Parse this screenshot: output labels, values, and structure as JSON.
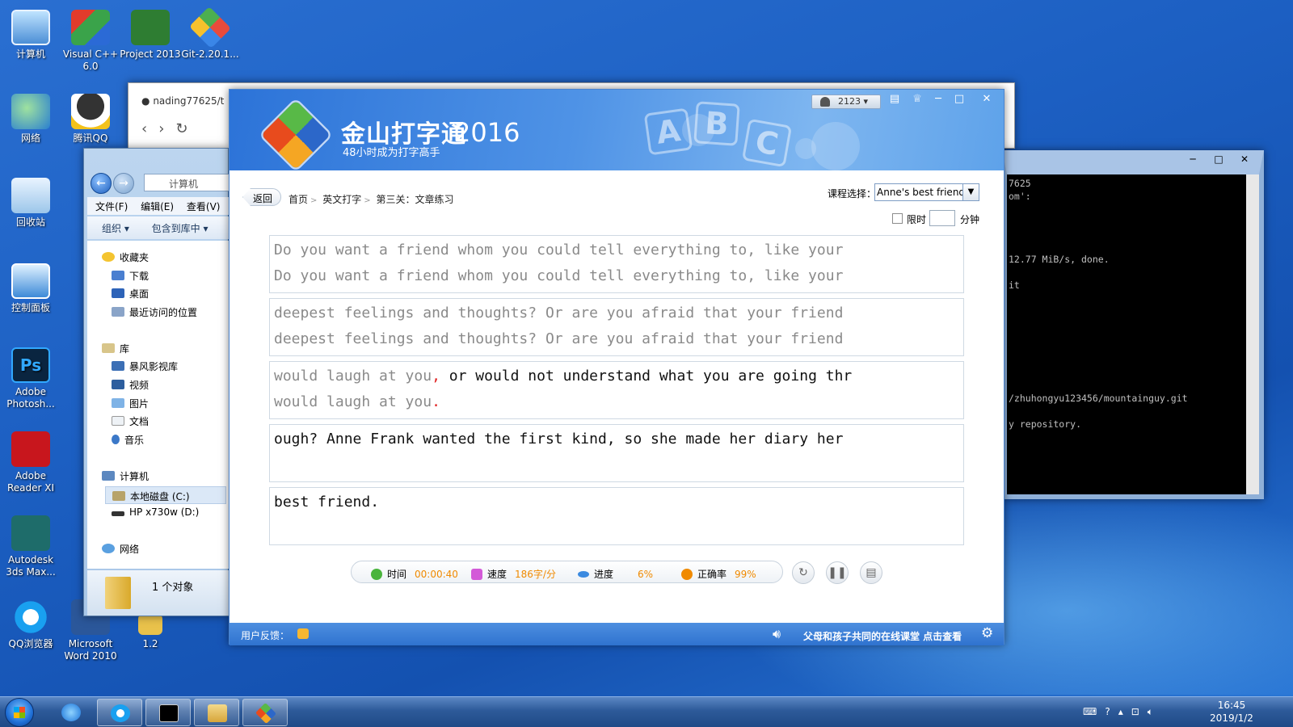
{
  "desktop": {
    "icons": [
      {
        "label": "计算机"
      },
      {
        "label": "Visual C++ 6.0"
      },
      {
        "label": "Project 2013"
      },
      {
        "label": "Git-2.20.1..."
      },
      {
        "label": "网络"
      },
      {
        "label": "腾讯QQ"
      },
      {
        "label": "回收站"
      },
      {
        "label": "控制面板"
      },
      {
        "label": "Adobe Photosh..."
      },
      {
        "label": "Adobe Reader XI"
      },
      {
        "label": "Autodesk 3ds Max..."
      },
      {
        "label": "QQ浏览器"
      },
      {
        "label": "Microsoft Word 2010"
      },
      {
        "label": "1.2"
      }
    ]
  },
  "browser": {
    "tab_title": "nading77625/t"
  },
  "explorer": {
    "address": "计算机",
    "menu": [
      "文件(F)",
      "编辑(E)",
      "查看(V)"
    ],
    "toolbar": [
      "组织 ▾",
      "包含到库中 ▾"
    ],
    "tree": [
      {
        "label": "收藏夹"
      },
      {
        "label": "下载"
      },
      {
        "label": "桌面"
      },
      {
        "label": "最近访问的位置"
      },
      {
        "label": "库"
      },
      {
        "label": "暴风影视库"
      },
      {
        "label": "视频"
      },
      {
        "label": "图片"
      },
      {
        "label": "文档"
      },
      {
        "label": "音乐"
      },
      {
        "label": "计算机"
      },
      {
        "label": "本地磁盘 (C:)"
      },
      {
        "label": "HP x730w (D:)"
      },
      {
        "label": "网络"
      }
    ],
    "status": "1 个对象"
  },
  "console": {
    "lines": [
      "7625",
      "om':",
      "12.77 MiB/s, done.",
      "it",
      "/zhuhongyu123456/mountainguy.git",
      "y repository."
    ]
  },
  "app": {
    "brand": "金山打字通",
    "year": "2016",
    "slogan": "48小时成为打字高手",
    "abc": [
      "A",
      "B",
      "C"
    ],
    "user": "2123",
    "back": "返回",
    "breadcrumb": [
      "首页",
      "英文打字",
      "第三关：文章练习"
    ],
    "course_label": "课程选择：",
    "course_value": "Anne's best friend",
    "limit_label": "限时",
    "limit_unit": "分钟",
    "blocks": [
      {
        "source": "Do you want a friend whom you could tell everything to, like your",
        "typed": "Do you want a friend whom you could tell everything to, like your"
      },
      {
        "source": "deepest feelings and thoughts? Or are you afraid that your friend",
        "typed": "deepest feelings and thoughts? Or are you afraid that your friend"
      },
      {
        "source_done": "would laugh at you",
        "source_err": ",",
        "source_rest": " or would not understand what you are going thr",
        "typed": "would laugh at you",
        "typed_err": "."
      },
      {
        "source": "ough? Anne Frank wanted the first kind, so she made her diary her",
        "typed": ""
      },
      {
        "source": "best friend.",
        "typed": ""
      }
    ],
    "stats": {
      "time_label": "时间",
      "time_value": "00:00:40",
      "speed_label": "速度",
      "speed_value": "186字/分",
      "progress_label": "进度",
      "progress_value": "6%",
      "accuracy_label": "正确率",
      "accuracy_value": "99%"
    },
    "footer": {
      "feedback": "用户反馈：",
      "promo": "父母和孩子共同的在线课堂 点击查看"
    }
  },
  "taskbar": {
    "time": "16:45",
    "date": "2019/1/2"
  }
}
